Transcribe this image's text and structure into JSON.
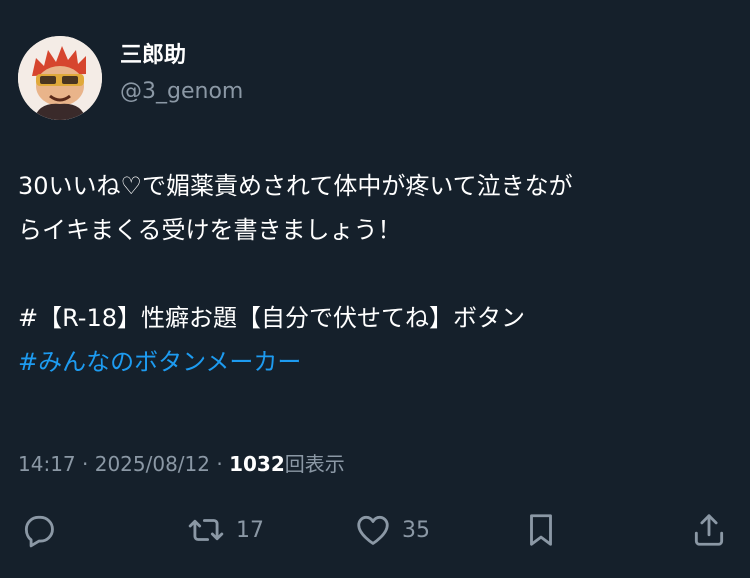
{
  "user": {
    "display_name": "三郎助",
    "handle": "@3_genom",
    "avatar_icon": "cartoon-avatar"
  },
  "tweet": {
    "lines": [
      "30いいね♡で媚薬責めされて体中が疼いて泣きなが",
      "らイキまくる受けを書きましょう！",
      "",
      "#【R-18】性癖お題【自分で伏せてね】ボタン"
    ],
    "hashtag_link": "#みんなのボタンメーカー"
  },
  "meta": {
    "time": "14:17",
    "separator": "·",
    "date": "2025/08/12",
    "views_count": "1032",
    "views_label": "回表示"
  },
  "actions": {
    "reply_icon": "reply-icon",
    "retweet_icon": "retweet-icon",
    "retweet_count": "17",
    "like_icon": "heart-icon",
    "like_count": "35",
    "bookmark_icon": "bookmark-icon",
    "share_icon": "share-icon"
  },
  "colors": {
    "background": "#15202b",
    "text_primary": "#ffffff",
    "text_secondary": "#8b98a5",
    "link": "#1d9bf0"
  }
}
